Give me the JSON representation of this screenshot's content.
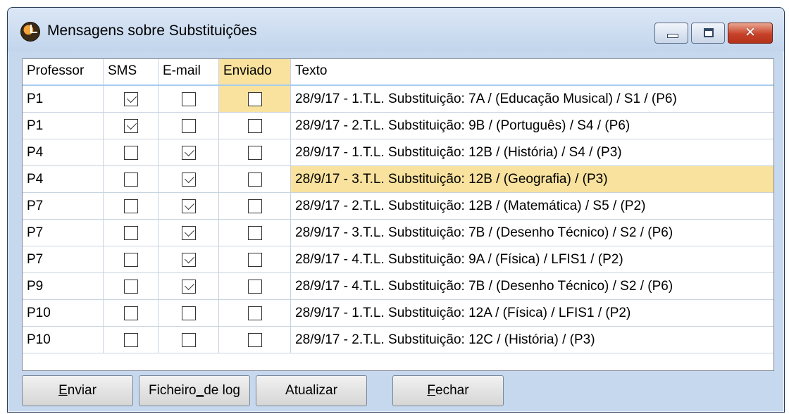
{
  "window": {
    "title": "Mensagens sobre Substituições",
    "close_symbol": "✕",
    "icons": {
      "app": "clock-icon",
      "minimize": "minimize-icon",
      "maximize": "maximize-icon",
      "close": "close-icon"
    }
  },
  "table": {
    "columns": [
      "Professor",
      "SMS",
      "E-mail",
      "Enviado",
      "Texto"
    ],
    "selected_column": "Enviado",
    "highlight_color": "#f8e29d",
    "rows": [
      {
        "professor": "P1",
        "sms": true,
        "email": false,
        "enviado": false,
        "texto": "28/9/17 - 1.T.L. Substituição: 7A / (Educação Musical) / S1 / (P6)"
      },
      {
        "professor": "P1",
        "sms": true,
        "email": false,
        "enviado": false,
        "texto": "28/9/17 - 2.T.L. Substituição: 9B / (Português) / S4 / (P6)"
      },
      {
        "professor": "P4",
        "sms": false,
        "email": true,
        "enviado": false,
        "texto": "28/9/17 - 1.T.L. Substituição: 12B / (História) / S4 / (P3)"
      },
      {
        "professor": "P4",
        "sms": false,
        "email": true,
        "enviado": false,
        "texto": "28/9/17 - 3.T.L. Substituição: 12B / (Geografia) / (P3)"
      },
      {
        "professor": "P7",
        "sms": false,
        "email": true,
        "enviado": false,
        "texto": "28/9/17 - 2.T.L. Substituição: 12B / (Matemática) / S5 / (P2)"
      },
      {
        "professor": "P7",
        "sms": false,
        "email": true,
        "enviado": false,
        "texto": "28/9/17 - 3.T.L. Substituição: 7B / (Desenho Técnico) / S2 / (P6)"
      },
      {
        "professor": "P7",
        "sms": false,
        "email": true,
        "enviado": false,
        "texto": "28/9/17 - 4.T.L. Substituição: 9A / (Física) / LFIS1 / (P2)"
      },
      {
        "professor": "P9",
        "sms": false,
        "email": true,
        "enviado": false,
        "texto": "28/9/17 - 4.T.L. Substituição: 7B / (Desenho Técnico) / S2 / (P6)"
      },
      {
        "professor": "P10",
        "sms": false,
        "email": false,
        "enviado": false,
        "texto": "28/9/17 - 1.T.L. Substituição: 12A / (Física) / LFIS1 / (P2)"
      },
      {
        "professor": "P10",
        "sms": false,
        "email": false,
        "enviado": false,
        "texto": "28/9/17 - 2.T.L. Substituição: 12C / (História) / (P3)"
      }
    ]
  },
  "buttons": {
    "enviar": {
      "pre": "",
      "key": "E",
      "post": "nviar"
    },
    "ficheiro": {
      "pre": "Ficheiro",
      "key": "_",
      "post": "de log"
    },
    "atualizar": {
      "pre": "Atualizar",
      "key": "",
      "post": ""
    },
    "fechar": {
      "pre": "",
      "key": "F",
      "post": "echar"
    }
  }
}
